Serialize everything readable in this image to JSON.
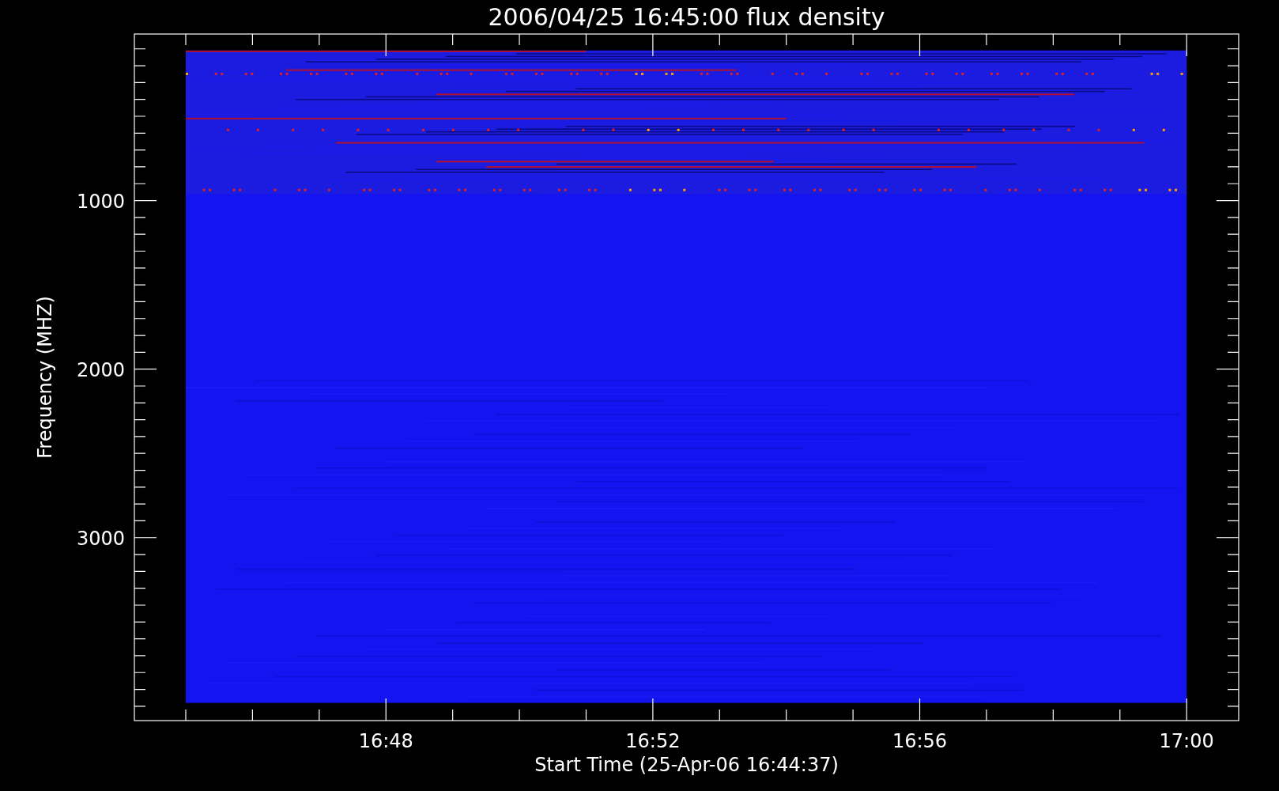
{
  "plot": {
    "title": "2006/04/25 16:45:00 flux density",
    "x_axis": {
      "label": "Start Time (25-Apr-06 16:44:37)",
      "ticks": [
        "16:48",
        "16:52",
        "16:56",
        "17:00"
      ]
    },
    "y_axis": {
      "label": "Frequency (MHZ)",
      "ticks": [
        "1000",
        "2000",
        "3000"
      ]
    }
  }
}
